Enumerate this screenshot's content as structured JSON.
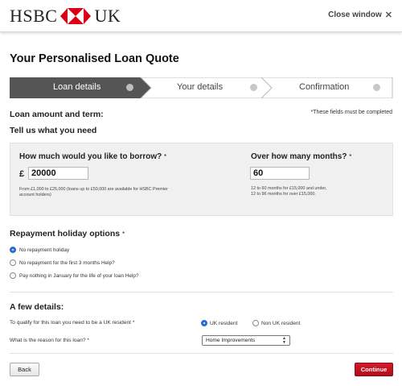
{
  "header": {
    "brand_left": "HSBC",
    "brand_right": "UK",
    "close_label": "Close window",
    "close_icon": "x-icon"
  },
  "page_title": "Your Personalised Loan Quote",
  "steps": [
    {
      "label": "Loan details",
      "active": true
    },
    {
      "label": "Your details",
      "active": false
    },
    {
      "label": "Confirmation",
      "active": false
    }
  ],
  "loan_section": {
    "heading": "Loan amount and term:",
    "required_note": "*These fields must be completed",
    "subheading": "Tell us what you need"
  },
  "borrow": {
    "label": "How much would you like to borrow?",
    "star": "*",
    "currency": "£",
    "value": "20000",
    "help": "From £1,000 to £25,000 (loans up to £50,000 are available for HSBC Premier account holders)"
  },
  "months": {
    "label": "Over how many months?",
    "star": "*",
    "value": "60",
    "help_line1": "12 to 60 months for £15,000 and under,",
    "help_line2": "12 to 96 months for over £15,000."
  },
  "repayment_holiday": {
    "heading": "Repayment holiday options",
    "star": "*",
    "options": [
      {
        "label": "No repayment holiday",
        "checked": true
      },
      {
        "label": "No repayment for the first 3 months Help?",
        "checked": false
      },
      {
        "label": "Pay nothing in January for the life of your loan Help?",
        "checked": false
      }
    ]
  },
  "few_details": {
    "heading": "A few details:",
    "residency_question": "To qualify for this loan you need to be a UK resident *",
    "residency_options": [
      {
        "label": "UK resident",
        "checked": true
      },
      {
        "label": "Non UK resident",
        "checked": false
      }
    ],
    "reason_question": "What is the reason for this loan? *",
    "reason_value": "Home Improvements"
  },
  "buttons": {
    "back": "Back",
    "continue": "Continue"
  },
  "colors": {
    "brand_red": "#db0011",
    "active_step": "#555555",
    "continue_button": "#c0121f",
    "radio_selected": "#2a6fd0"
  }
}
